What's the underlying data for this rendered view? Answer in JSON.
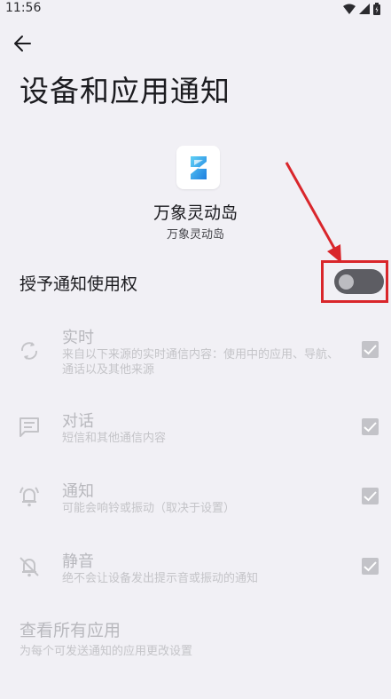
{
  "status": {
    "time": "11:56"
  },
  "header": {
    "title": "设备和应用通知"
  },
  "app": {
    "name": "万象灵动岛",
    "subtitle": "万象灵动岛"
  },
  "grant": {
    "label": "授予通知使用权",
    "enabled": false
  },
  "categories": [
    {
      "title": "实时",
      "desc": "来自以下来源的实时通信内容：使用中的应用、导航、通话以及其他来源",
      "icon": "sync-icon",
      "checked": true
    },
    {
      "title": "对话",
      "desc": "短信和其他通信内容",
      "icon": "message-icon",
      "checked": true
    },
    {
      "title": "通知",
      "desc": "可能会响铃或振动（取决于设置）",
      "icon": "bell-ring-icon",
      "checked": true
    },
    {
      "title": "静音",
      "desc": "绝不会让设备发出提示音或振动的通知",
      "icon": "bell-off-icon",
      "checked": true
    }
  ],
  "all_apps": {
    "title": "查看所有应用",
    "desc": "为每个可发送通知的应用更改设置"
  },
  "colors": {
    "highlight": "#d9262b",
    "background": "#f1f0f5",
    "toggle_off": "#5d5d63"
  }
}
